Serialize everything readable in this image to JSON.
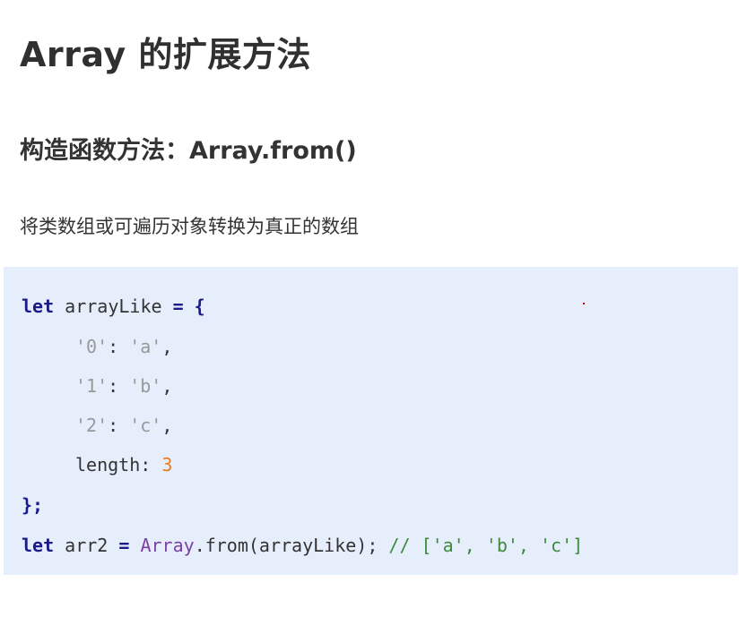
{
  "title": "Array 的扩展方法",
  "subtitle": "构造函数方法：Array.from()",
  "description": "将类数组或可遍历对象转换为真正的数组",
  "code": {
    "line1": {
      "kw": "let",
      "name": " arrayLike ",
      "op": "= {"
    },
    "line2": {
      "key": "'0'",
      "sep": ": ",
      "val": "'a'",
      "end": ","
    },
    "line3": {
      "key": "'1'",
      "sep": ": ",
      "val": "'b'",
      "end": ","
    },
    "line4": {
      "key": "'2'",
      "sep": ": ",
      "val": "'c'",
      "end": ","
    },
    "line5": {
      "key": "length",
      "sep": ": ",
      "val": "3"
    },
    "line6": {
      "text": "};"
    },
    "line7": {
      "kw": "let",
      "name": " arr2 ",
      "op": "=",
      "space": " ",
      "cls": "Array",
      "call": ".from(arrayLike);",
      "comment": " // ['a', 'b', 'c']"
    }
  },
  "colors": {
    "code_background": "#e6eefc",
    "keyword": "#1a1a8a",
    "string": "#999999",
    "number": "#e87d1f",
    "class": "#7b3fa6",
    "comment": "#3c8a3c"
  }
}
